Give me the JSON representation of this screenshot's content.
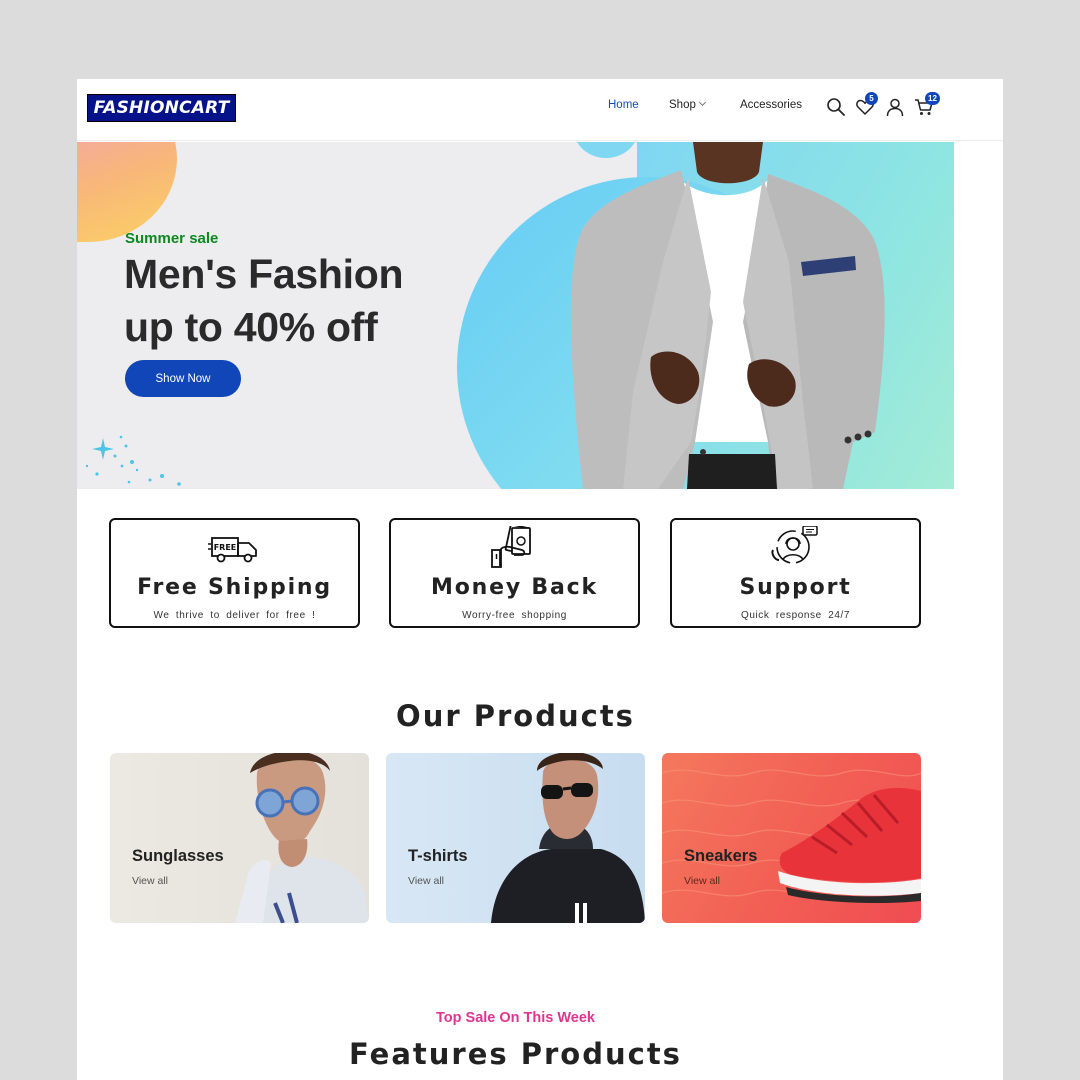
{
  "brand": {
    "logo_text": "FASHIONCART"
  },
  "nav": {
    "home": "Home",
    "shop": "Shop",
    "accessories": "Accessories"
  },
  "header_icons": {
    "search": "search-icon",
    "wishlist": "heart-icon",
    "wishlist_count": "5",
    "account": "user-icon",
    "cart": "cart-icon",
    "cart_count": "12"
  },
  "hero": {
    "eyebrow": "Summer sale",
    "title_line1": "Men's Fashion",
    "title_line2": "up to 40% off",
    "cta": "Show Now"
  },
  "features": [
    {
      "icon": "truck-icon",
      "icon_text": "FREE",
      "title": "Free Shipping",
      "subtitle": "We thrive to deliver for free !"
    },
    {
      "icon": "money-icon",
      "title": "Money Back",
      "subtitle": "Worry-free shopping"
    },
    {
      "icon": "support-icon",
      "title": "Support",
      "subtitle": "Quick response 24/7"
    }
  ],
  "products_section": {
    "title": "Our Products",
    "items": [
      {
        "name": "Sunglasses",
        "link": "View all"
      },
      {
        "name": "T-shirts",
        "link": "View all"
      },
      {
        "name": "Sneakers",
        "link": "View all"
      }
    ]
  },
  "featured_section": {
    "eyebrow": "Top Sale On This Week",
    "title": "Features Products"
  },
  "colors": {
    "accent": "#1146b8",
    "logo_bg": "#06128a",
    "sale_green": "#0a8a1f",
    "pink": "#e0358e"
  }
}
